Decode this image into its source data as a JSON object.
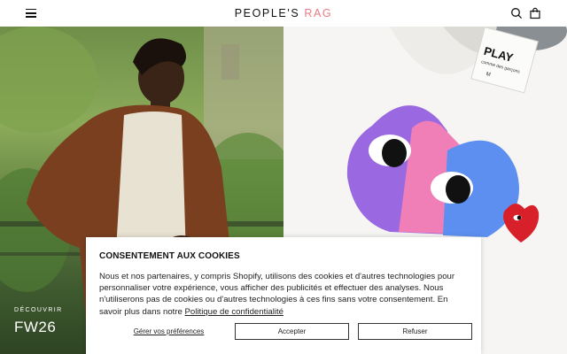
{
  "header": {
    "logo_part1": "PEOPLE'S ",
    "logo_part2": "RAG",
    "menu_icon": "hamburger-menu-icon",
    "search_icon": "search-icon",
    "bag_icon": "shopping-bag-icon",
    "accent_color": "#e87a86"
  },
  "hero": {
    "kicker": "DÉCOUVRIR",
    "title": "FW26",
    "left_image": "model in brown cardigan outdoors",
    "right_image": "white tee with PLAY heart print",
    "tag_text": "PLAY",
    "tag_sub": "comme des garçons",
    "tag_size": "M"
  },
  "cookie": {
    "title": "CONSENTEMENT AUX COOKIES",
    "body": "Nous et nos partenaires, y compris Shopify, utilisons des cookies et d'autres technologies pour personnaliser votre expérience, vous afficher des publicités et effectuer des analyses. Nous n'utiliserons pas de cookies ou d'autres technologies à ces fins sans votre consentement. En savoir plus dans notre ",
    "policy_link": "Politique de confidentialité",
    "manage_label": "Gérer vos préférences",
    "accept_label": "Accepter",
    "refuse_label": "Refuser"
  }
}
